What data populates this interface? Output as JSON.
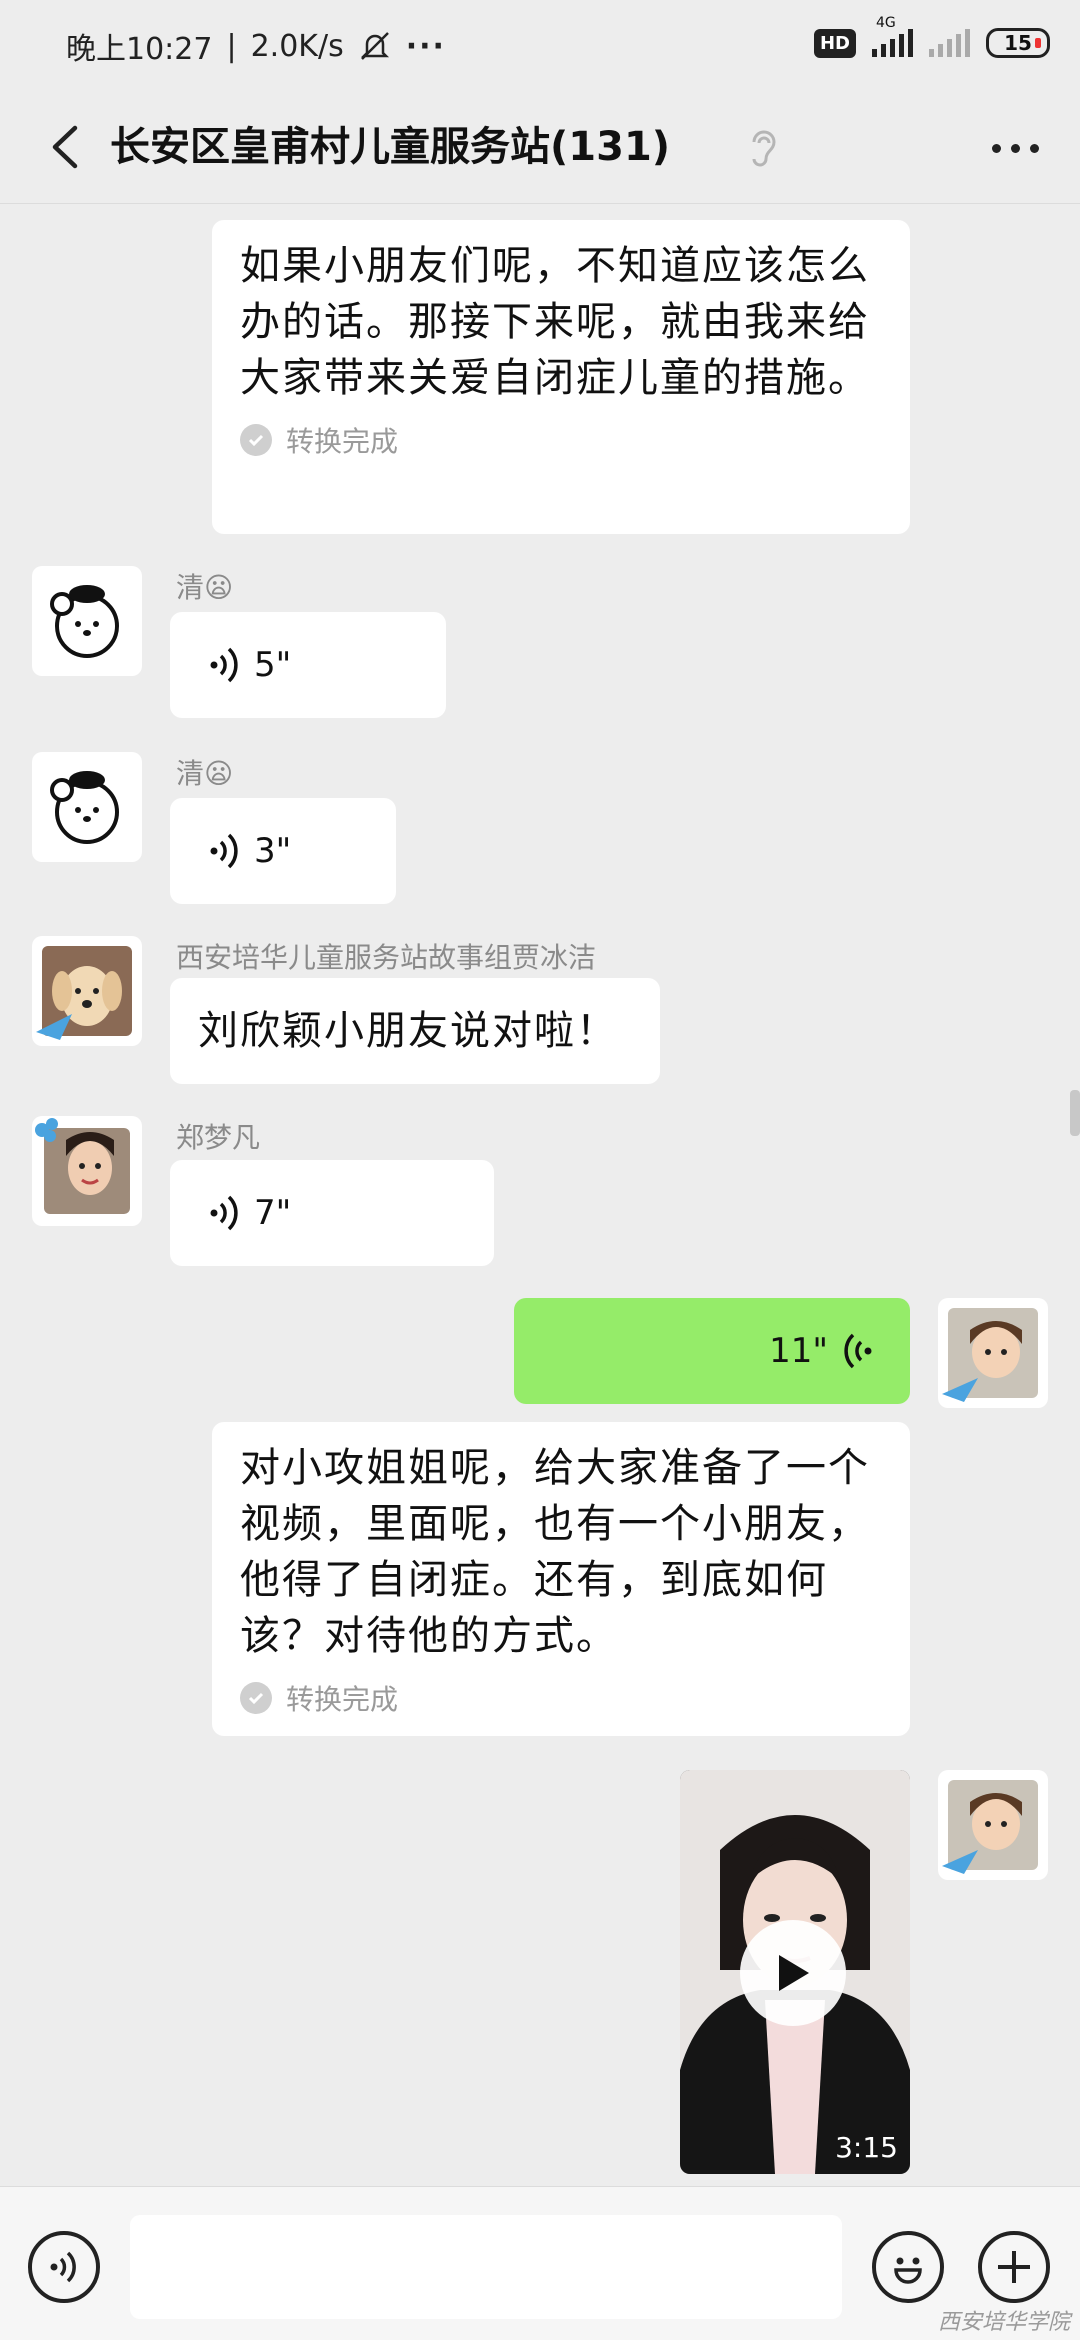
{
  "status_bar": {
    "time": "晚上10:27",
    "speed": "2.0K/s",
    "dots": "···",
    "hd": "HD",
    "network": "4G",
    "battery": "15"
  },
  "nav": {
    "title": "长安区皇甫村儿童服务站(131)"
  },
  "messages": {
    "m1": {
      "text": "如果小朋友们呢，不知道应该怎么办的话。那接下来呢，就由我来给大家带来关爱自闭症儿童的措施。",
      "converted": "转换完成"
    },
    "m2": {
      "sender": "清😦",
      "duration": "5\""
    },
    "m3": {
      "sender": "清😦",
      "duration": "3\""
    },
    "m4": {
      "sender": "西安培华儿童服务站故事组贾冰洁",
      "text": "刘欣颖小朋友说对啦！"
    },
    "m5": {
      "sender": "郑梦凡",
      "duration": "7\""
    },
    "m6": {
      "duration": "11\""
    },
    "m7": {
      "text": "对小攻姐姐呢，给大家准备了一个视频，里面呢，也有一个小朋友，他得了自闭症。还有，到底如何该？对待他的方式。",
      "converted": "转换完成"
    },
    "m8": {
      "video_duration": "3:15"
    }
  },
  "watermark": "西安培华学院",
  "colors": {
    "background": "#EDEDED",
    "bubble_white": "#FFFFFF",
    "bubble_green": "#95EC69"
  }
}
